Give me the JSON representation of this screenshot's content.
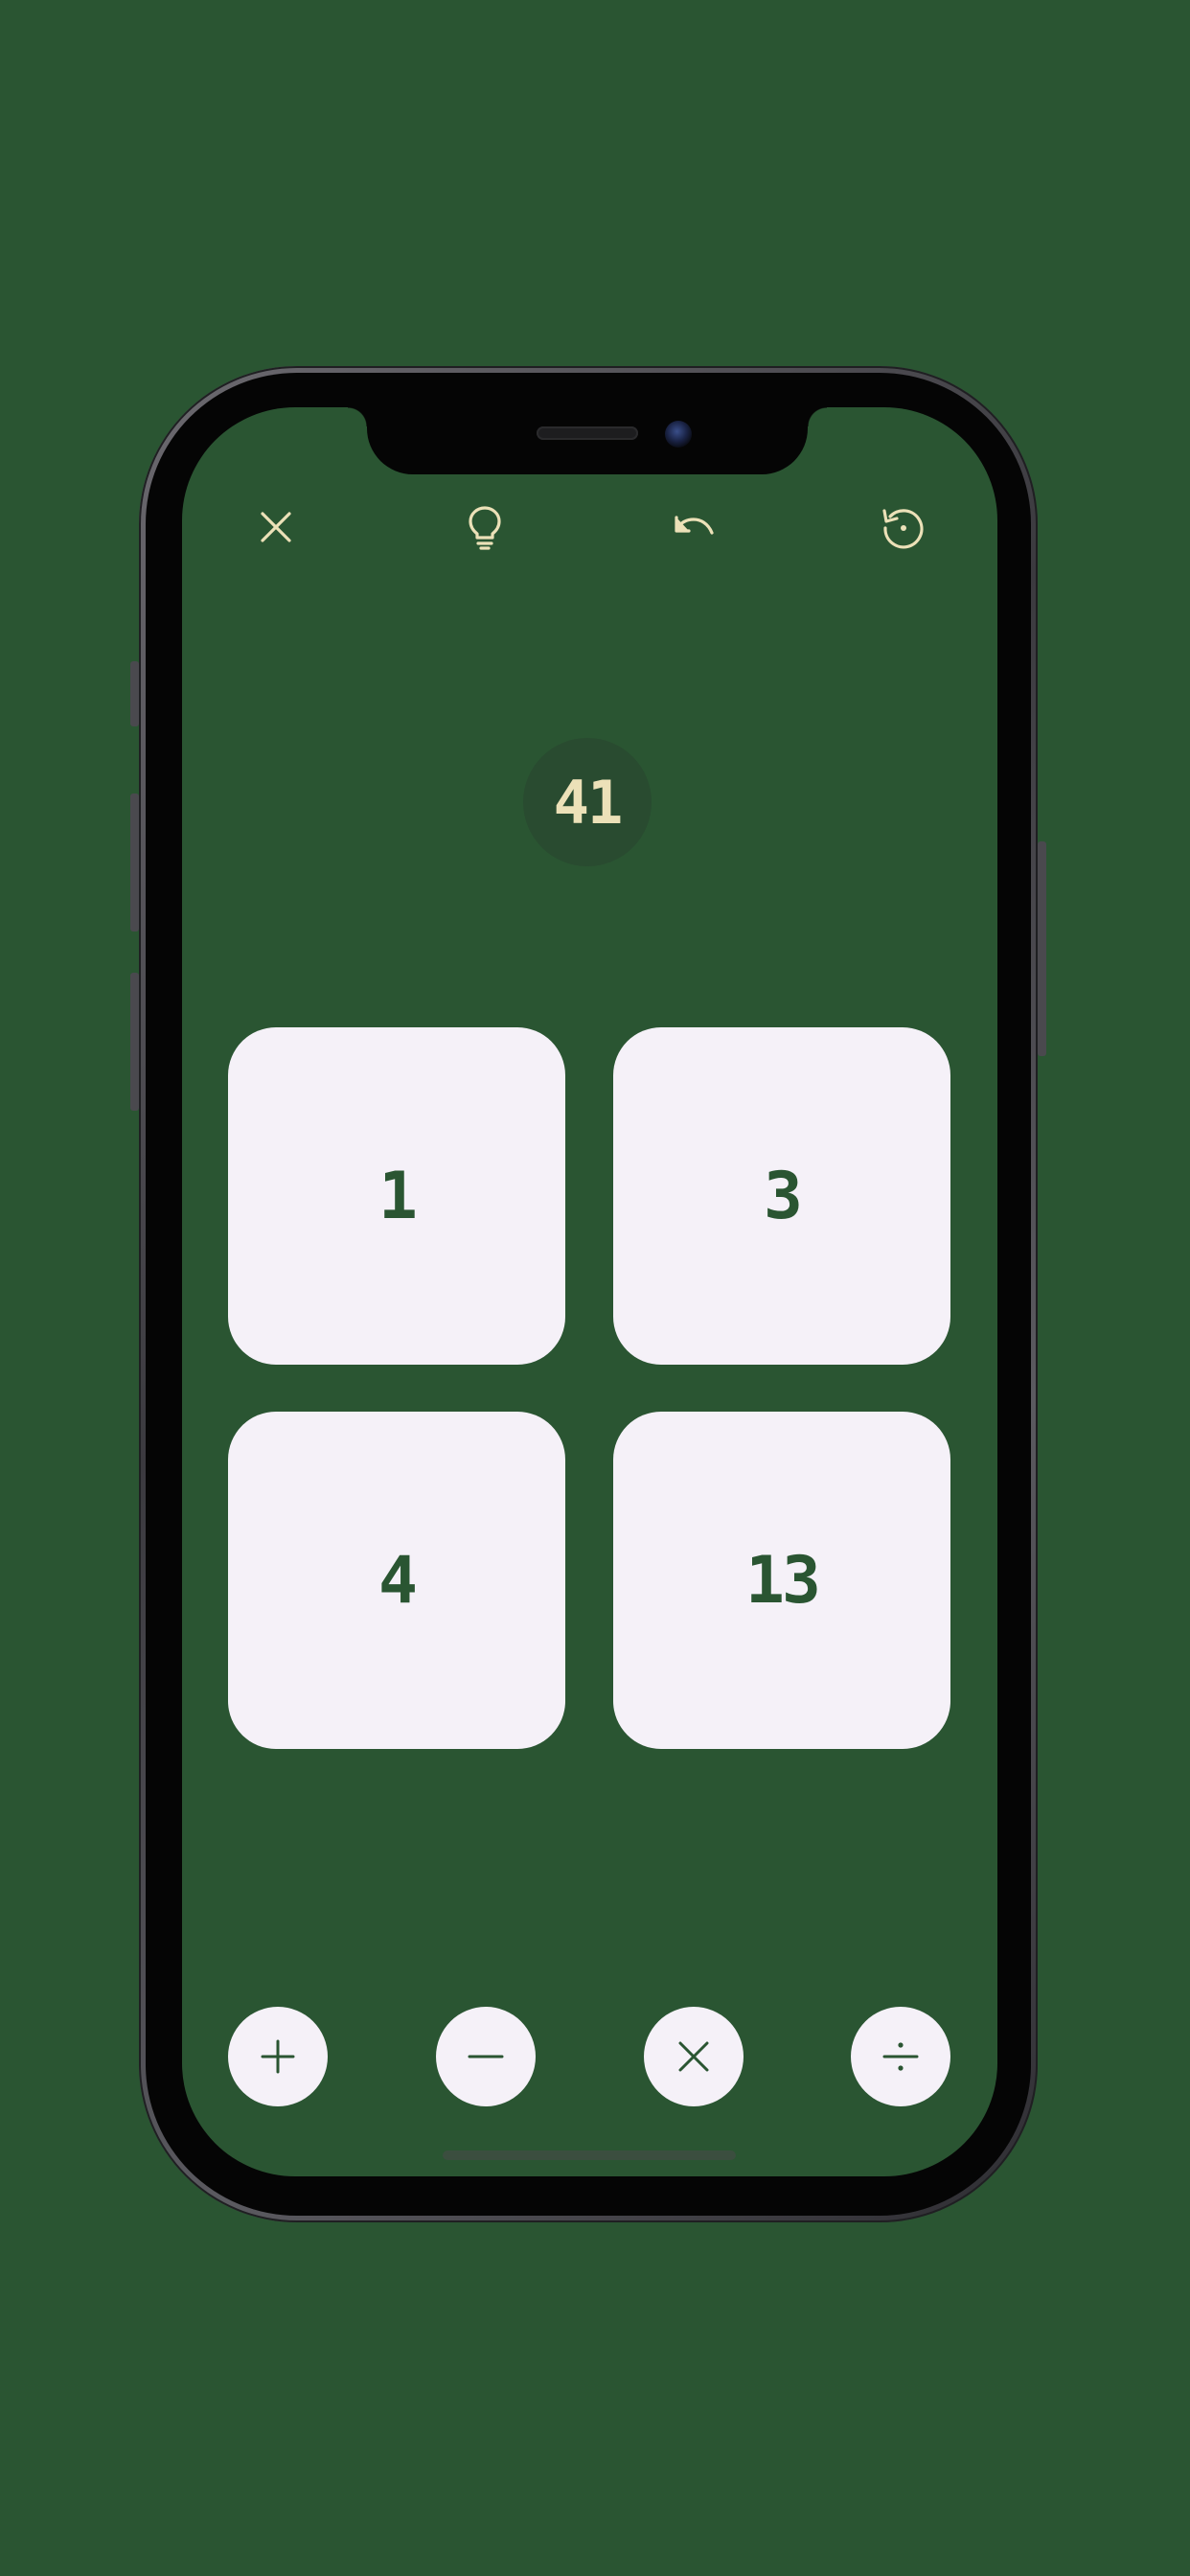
{
  "game": {
    "target": "41",
    "cards": [
      {
        "value": "1"
      },
      {
        "value": "3"
      },
      {
        "value": "4"
      },
      {
        "value": "13"
      }
    ]
  },
  "toolbar": {
    "icons": [
      "close-icon",
      "lightbulb-icon",
      "undo-icon",
      "restart-icon"
    ]
  },
  "operators": {
    "icons": [
      "plus-icon",
      "minus-icon",
      "multiply-icon",
      "divide-icon"
    ]
  },
  "colors": {
    "background": "#2a5532",
    "accent": "#ece1b8",
    "card": "#f5f1f8",
    "target_circle": "#294b30"
  }
}
